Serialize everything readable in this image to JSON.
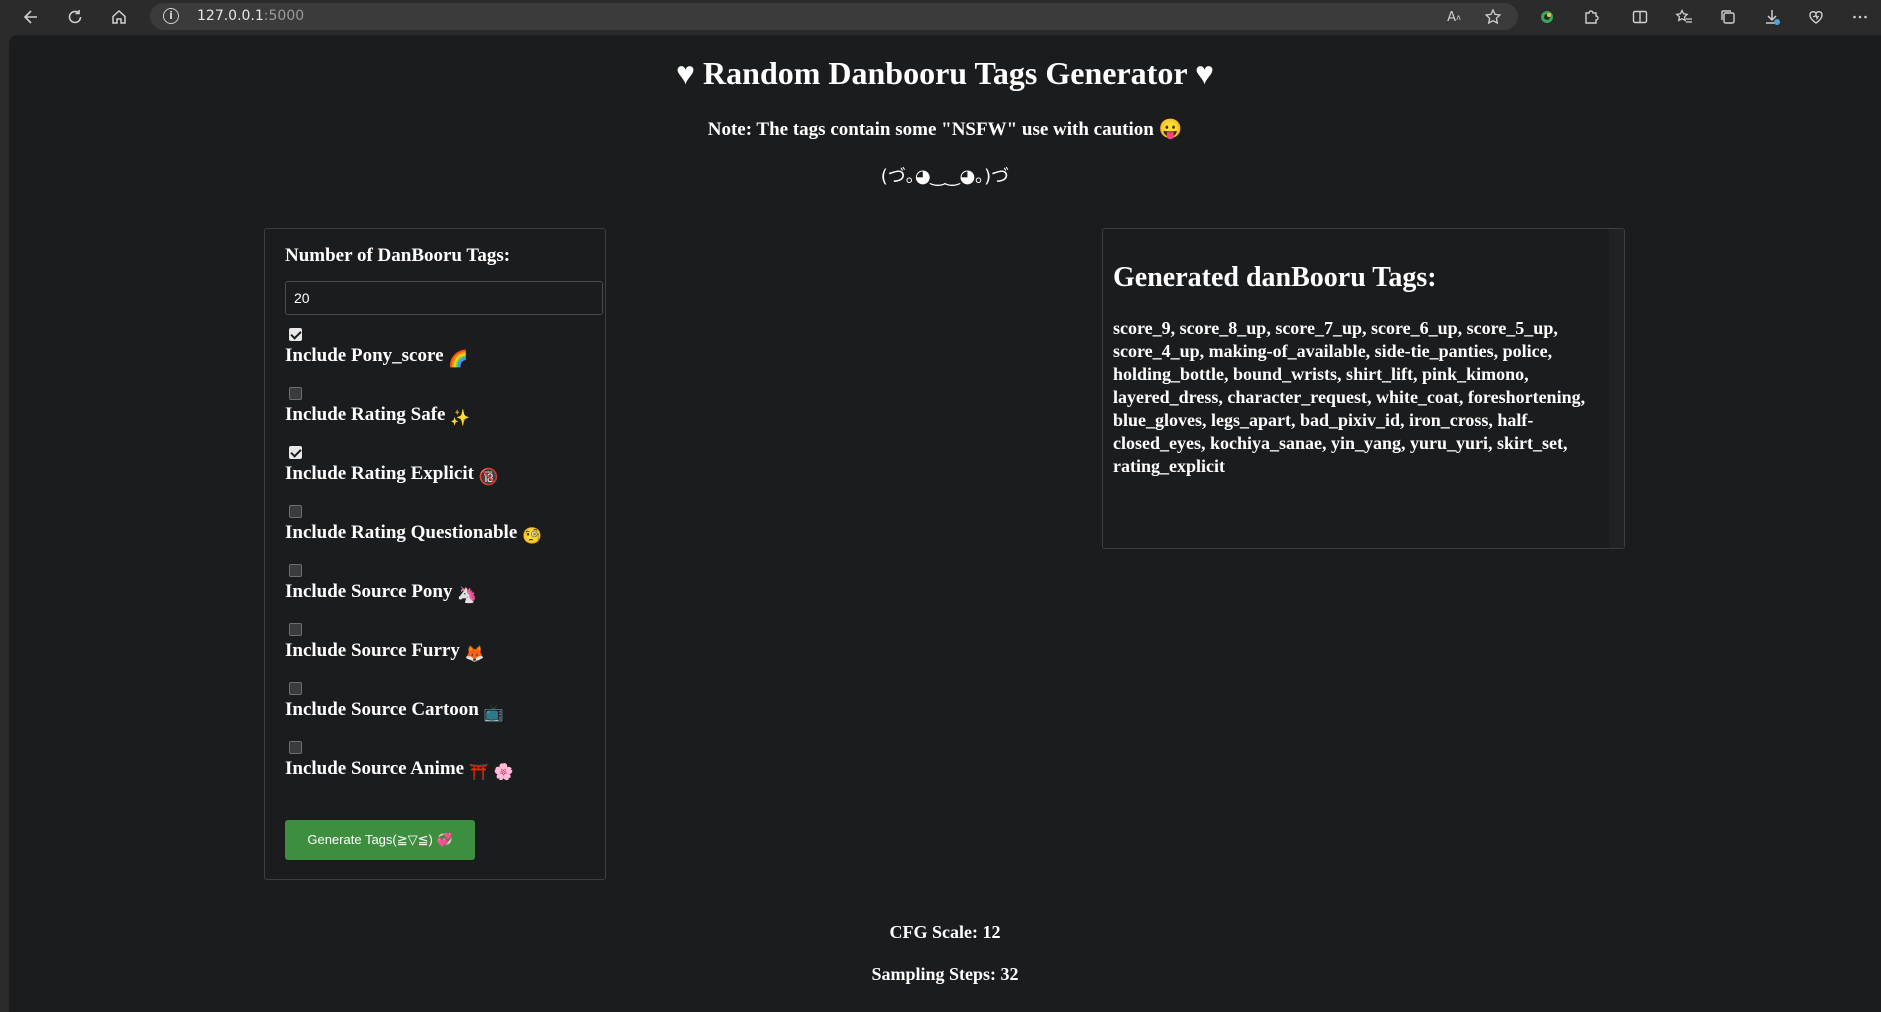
{
  "browser": {
    "url_host": "127.0.0.1",
    "url_port": ":5000"
  },
  "page": {
    "title": "♥ Random Danbooru Tags Generator ♥",
    "note": "Note: The tags contain some \"NSFW\" use with caution 😛",
    "kaomoji": "(づ｡◕‿‿◕｡)づ"
  },
  "form": {
    "num_label": "Number of DanBooru Tags:",
    "num_value": "20",
    "options": [
      {
        "label": "Include Pony_score",
        "emoji": "🌈",
        "checked": true
      },
      {
        "label": "Include Rating Safe",
        "emoji": "✨",
        "checked": false
      },
      {
        "label": "Include Rating Explicit",
        "emoji": "🔞",
        "checked": true
      },
      {
        "label": "Include Rating Questionable",
        "emoji": "🧐",
        "checked": false
      },
      {
        "label": "Include Source Pony",
        "emoji": "🦄",
        "checked": false
      },
      {
        "label": "Include Source Furry",
        "emoji": "🦊",
        "checked": false
      },
      {
        "label": "Include Source Cartoon",
        "emoji": "📺",
        "checked": false
      },
      {
        "label": "Include Source Anime",
        "emoji": "⛩️ 🌸",
        "checked": false
      }
    ],
    "generate_label": "Generate Tags(≧▽≦) 💞"
  },
  "result": {
    "title": "Generated danBooru Tags:",
    "tags": "score_9, score_8_up, score_7_up, score_6_up, score_5_up, score_4_up, making-of_available, side-tie_panties, police, holding_bottle, bound_wrists, shirt_lift, pink_kimono, layered_dress, character_request, white_coat, foreshortening, blue_gloves, legs_apart, bad_pixiv_id, iron_cross, half-closed_eyes, kochiya_sanae, yin_yang, yuru_yuri, skirt_set, rating_explicit"
  },
  "stats": {
    "cfg": "CFG Scale: 12",
    "steps": "Sampling Steps: 32"
  }
}
